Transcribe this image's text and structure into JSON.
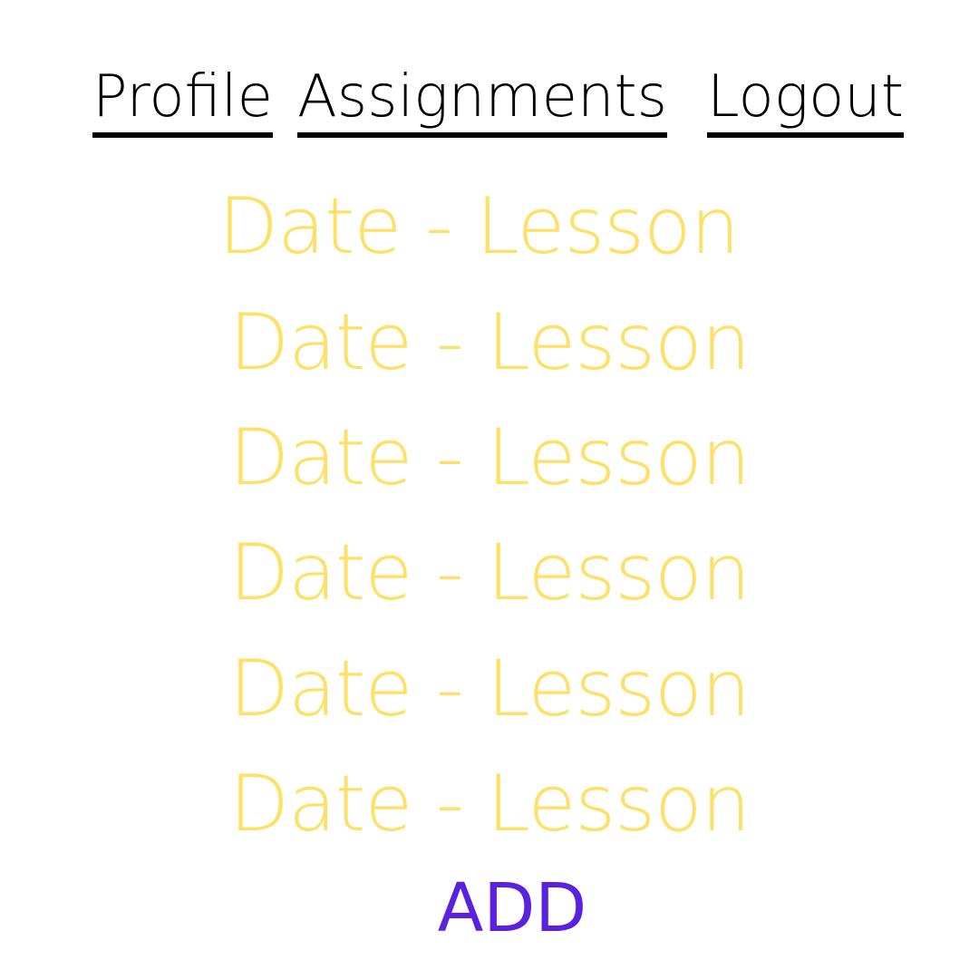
{
  "nav": {
    "profile_label": "Profile",
    "assignments_label": "Assignments",
    "logout_label": "Logout",
    "text_color": "#000000"
  },
  "lessons": {
    "color": "#FFE066",
    "items": [
      {
        "label": "Date - Lesson"
      },
      {
        "label": "Date - Lesson"
      },
      {
        "label": "Date - Lesson"
      },
      {
        "label": "Date - Lesson"
      },
      {
        "label": "Date - Lesson"
      },
      {
        "label": "Date - Lesson"
      }
    ]
  },
  "add": {
    "label": "ADD",
    "color": "#5B21E0"
  }
}
